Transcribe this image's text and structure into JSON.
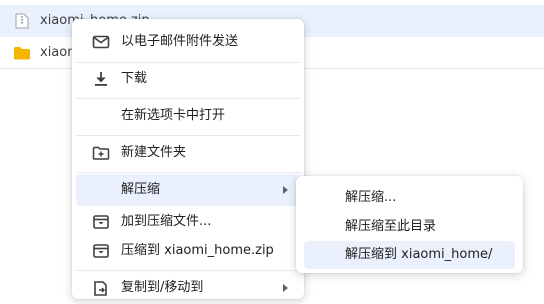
{
  "files": [
    {
      "name": "xiaomi_home.zip",
      "icon": "zip-file-icon"
    },
    {
      "name": "xiaomi_home",
      "icon": "folder-icon"
    }
  ],
  "context_menu": {
    "items": [
      {
        "label": "以电子邮件附件发送",
        "icon": "mail-icon"
      },
      {
        "label": "下载",
        "icon": "download-icon"
      },
      {
        "label": "在新选项卡中打开",
        "icon": ""
      },
      {
        "label": "新建文件夹",
        "icon": "new-folder-icon"
      },
      {
        "label": "解压缩",
        "icon": ""
      },
      {
        "label": "加到压缩文件...",
        "icon": "archive-icon"
      },
      {
        "label": "压缩到 xiaomi_home.zip",
        "icon": "archive-icon"
      },
      {
        "label": "复制到/移动到",
        "icon": "copy-move-icon"
      }
    ]
  },
  "submenu": {
    "items": [
      {
        "label": "解压缩..."
      },
      {
        "label": "解压缩至此目录"
      },
      {
        "label": "解压缩到 xiaomi_home/"
      }
    ]
  },
  "colors": {
    "highlight": "#eaf1fd",
    "folder": "#f4b400",
    "icon": "#3c4043"
  }
}
